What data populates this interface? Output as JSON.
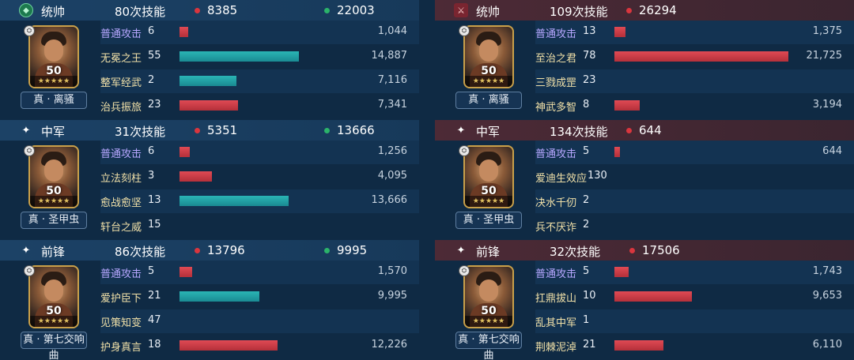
{
  "panels": [
    {
      "side": "left",
      "sections": [
        {
          "role": "统帅",
          "role_icon": "gem-icon",
          "casts": "80次技能",
          "red_stat": "8385",
          "green_stat": "22003",
          "level": "50",
          "tag": "真 · 离骚",
          "rows": [
            {
              "name": "普通攻击",
              "count": "6",
              "damage": "1,044",
              "bar": "red",
              "fill": 0.048,
              "basic": true
            },
            {
              "name": "无冕之王",
              "count": "55",
              "damage": "14,887",
              "bar": "teal",
              "fill": 0.685,
              "basic": false
            },
            {
              "name": "整军经武",
              "count": "2",
              "damage": "7,116",
              "bar": "teal",
              "fill": 0.327,
              "basic": false
            },
            {
              "name": "治兵振旅",
              "count": "23",
              "damage": "7,341",
              "bar": "red",
              "fill": 0.338,
              "basic": false
            }
          ]
        },
        {
          "role": "中军",
          "role_icon": "sparkle-icon",
          "casts": "31次技能",
          "red_stat": "5351",
          "green_stat": "13666",
          "level": "50",
          "tag": "真 · 圣甲虫",
          "rows": [
            {
              "name": "普通攻击",
              "count": "6",
              "damage": "1,256",
              "bar": "red",
              "fill": 0.058,
              "basic": true
            },
            {
              "name": "立法刻柱",
              "count": "3",
              "damage": "4,095",
              "bar": "red",
              "fill": 0.188,
              "basic": false
            },
            {
              "name": "愈战愈坚",
              "count": "13",
              "damage": "13,666",
              "bar": "teal",
              "fill": 0.629,
              "basic": false
            },
            {
              "name": "轩台之威",
              "count": "15",
              "damage": "",
              "bar": "none",
              "fill": 0,
              "basic": false
            }
          ]
        },
        {
          "role": "前锋",
          "role_icon": "sparkle-icon",
          "casts": "86次技能",
          "red_stat": "13796",
          "green_stat": "9995",
          "level": "50",
          "tag": "真 · 第七交响曲",
          "rows": [
            {
              "name": "普通攻击",
              "count": "5",
              "damage": "1,570",
              "bar": "red",
              "fill": 0.072,
              "basic": true
            },
            {
              "name": "爱护臣下",
              "count": "21",
              "damage": "9,995",
              "bar": "teal",
              "fill": 0.46,
              "basic": false
            },
            {
              "name": "见策知变",
              "count": "47",
              "damage": "",
              "bar": "none",
              "fill": 0,
              "basic": false
            },
            {
              "name": "护身真言",
              "count": "18",
              "damage": "12,226",
              "bar": "red",
              "fill": 0.563,
              "basic": false
            }
          ]
        }
      ]
    },
    {
      "side": "right",
      "sections": [
        {
          "role": "统帅",
          "role_icon": "sword-icon",
          "casts": "109次技能",
          "red_stat": "26294",
          "green_stat": "",
          "level": "50",
          "tag": "真 · 离骚",
          "rows": [
            {
              "name": "普通攻击",
              "count": "13",
              "damage": "1,375",
              "bar": "red",
              "fill": 0.063,
              "basic": true
            },
            {
              "name": "至治之君",
              "count": "78",
              "damage": "21,725",
              "bar": "red",
              "fill": 1.0,
              "basic": false
            },
            {
              "name": "三戮成罡",
              "count": "23",
              "damage": "",
              "bar": "none",
              "fill": 0,
              "basic": false
            },
            {
              "name": "神武多智",
              "count": "8",
              "damage": "3,194",
              "bar": "red",
              "fill": 0.147,
              "basic": false
            }
          ]
        },
        {
          "role": "中军",
          "role_icon": "sparkle-icon",
          "casts": "134次技能",
          "red_stat": "644",
          "green_stat": "",
          "level": "50",
          "tag": "真 · 圣甲虫",
          "rows": [
            {
              "name": "普通攻击",
              "count": "5",
              "damage": "644",
              "bar": "red",
              "fill": 0.03,
              "basic": true
            },
            {
              "name": "爱迪生效应",
              "count": "130",
              "damage": "",
              "bar": "none",
              "fill": 0,
              "basic": false
            },
            {
              "name": "决水千仞",
              "count": "2",
              "damage": "",
              "bar": "none",
              "fill": 0,
              "basic": false
            },
            {
              "name": "兵不厌诈",
              "count": "2",
              "damage": "",
              "bar": "none",
              "fill": 0,
              "basic": false
            }
          ]
        },
        {
          "role": "前锋",
          "role_icon": "sparkle-icon",
          "casts": "32次技能",
          "red_stat": "17506",
          "green_stat": "",
          "level": "50",
          "tag": "真 · 第七交响曲",
          "rows": [
            {
              "name": "普通攻击",
              "count": "5",
              "damage": "1,743",
              "bar": "red",
              "fill": 0.08,
              "basic": true
            },
            {
              "name": "扛鼎拔山",
              "count": "10",
              "damage": "9,653",
              "bar": "red",
              "fill": 0.444,
              "basic": false
            },
            {
              "name": "乱其中军",
              "count": "1",
              "damage": "",
              "bar": "none",
              "fill": 0,
              "basic": false
            },
            {
              "name": "荆棘泥淖",
              "count": "21",
              "damage": "6,110",
              "bar": "red",
              "fill": 0.281,
              "basic": false
            }
          ]
        }
      ]
    }
  ],
  "colors": {
    "background": "#0f2a44",
    "left_header": "#1c4266",
    "right_header": "#4d2a36",
    "bar_red": "#d03a44",
    "bar_teal": "#23a4a8",
    "basic_attack_text": "#b7a7ff",
    "skill_text": "#f0e0a8"
  },
  "stars": "★★★★★"
}
